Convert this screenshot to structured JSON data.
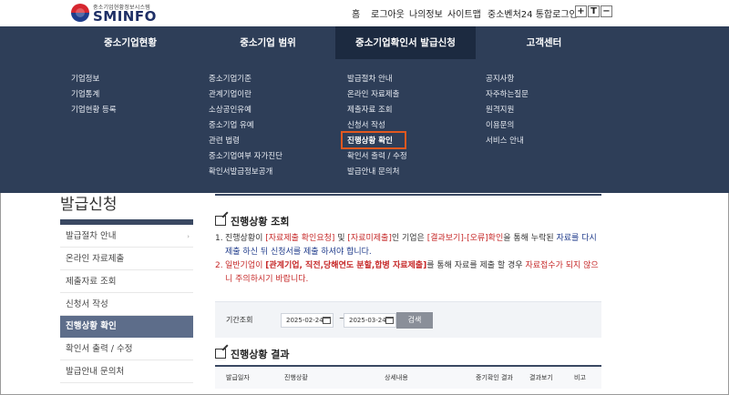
{
  "logo": {
    "subtitle": "중소기업현황정보시스템",
    "name": "SMINFO"
  },
  "util_links": [
    "홈",
    "로그아웃",
    "나의정보",
    "사이트맵",
    "중소벤처24 통합로그인"
  ],
  "font_controls": [
    "+",
    "T",
    "−"
  ],
  "nav": [
    {
      "label": "중소기업현황"
    },
    {
      "label": "중소기업 범위"
    },
    {
      "label": "중소기업확인서 발급신청"
    },
    {
      "label": "고객센터"
    }
  ],
  "mega_menu": {
    "col1": [
      "기업정보",
      "기업통계",
      "기업현황 등록"
    ],
    "col2": [
      "중소기업기준",
      "관계기업이란",
      "소상공인유예",
      "중소기업 유예",
      "관련 법령",
      "중소기업여부 자가진단",
      "확인서발급정보공개"
    ],
    "col3": [
      "발급절차 안내",
      "온라인 자료제출",
      "제출자료 조회",
      "신청서 작성",
      "진행상황 확인",
      "확인서 출력 / 수정",
      "발급안내 문의처"
    ],
    "col4": [
      "공지사항",
      "자주하는질문",
      "원격지원",
      "이용문의",
      "서비스 안내"
    ]
  },
  "lnb": {
    "title": "발급신청",
    "items": [
      "발급절차 안내",
      "온라인 자료제출",
      "제출자료 조회",
      "신청서 작성",
      "진행상황 확인",
      "확인서 출력 / 수정",
      "발급안내 문의처"
    ],
    "active_index": 4
  },
  "section1_title": "진행상황 조회",
  "notice1": {
    "num": "1.",
    "p1": "진행상황이 ",
    "p2": "[자료제출 확인요청]",
    "p3": " 및 ",
    "p4": "[자료미제출]",
    "p5": "인 기업은 ",
    "p6": "[결과보기]-[오류]",
    "p7": "확인",
    "p8": "을 통해 누락된 ",
    "p9": "자료를 다시 제출 하신 뒤 신청서를 제출 하셔야 합니다."
  },
  "notice2": {
    "num": "2.",
    "p1": "일반기업이 ",
    "p2": "[관계기업, 직전,당해연도 분할,합병 자료제출]",
    "p3": "를 통해 자료를 제출 할 경우 ",
    "p4": "자료접수가 되지 않으니 주의하시기 바랍니다."
  },
  "search": {
    "label": "기간조회",
    "from": "2025-02-24",
    "sep": "~",
    "to": "2025-03-24",
    "button": "검색"
  },
  "section2_title": "진행상황 결과",
  "table_headers": [
    "발급일자",
    "진행상황",
    "상세내용",
    "중기확인 결과",
    "결과보기",
    "비고"
  ],
  "colors": {
    "nav_bg": "#2e3e58",
    "highlight_box": "#e2581f",
    "active_lnb": "#5d6d8a",
    "notice_red": "#c62828"
  }
}
